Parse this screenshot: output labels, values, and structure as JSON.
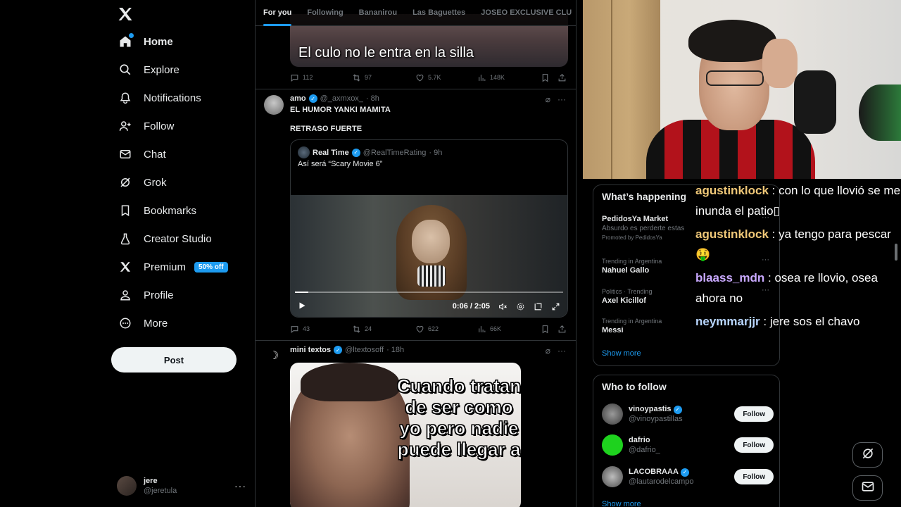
{
  "nav": {
    "items": [
      {
        "label": "Home",
        "icon": "home-icon"
      },
      {
        "label": "Explore",
        "icon": "search-icon"
      },
      {
        "label": "Notifications",
        "icon": "bell-icon"
      },
      {
        "label": "Follow",
        "icon": "person-add-icon"
      },
      {
        "label": "Chat",
        "icon": "mail-icon"
      },
      {
        "label": "Grok",
        "icon": "grok-icon"
      },
      {
        "label": "Bookmarks",
        "icon": "bookmark-icon"
      },
      {
        "label": "Creator Studio",
        "icon": "flask-icon"
      },
      {
        "label": "Premium",
        "icon": "x-logo-icon"
      },
      {
        "label": "Profile",
        "icon": "person-icon"
      },
      {
        "label": "More",
        "icon": "more-circle-icon"
      }
    ],
    "premium_badge": "50% off",
    "post_label": "Post",
    "account": {
      "name": "jere",
      "handle": "@jeretula",
      "more": "···"
    }
  },
  "feed": {
    "tabs": [
      "For you",
      "Following",
      "Bananirou",
      "Las Baguettes",
      "JOSEO EXCLUSIVE CLU"
    ],
    "top_post": {
      "caption": "El culo no le entra en la silla",
      "replies": "112",
      "reposts": "97",
      "likes": "5.7K",
      "views": "148K"
    },
    "post2": {
      "name": "amo",
      "handle": "@_axmxox_",
      "time": "· 8h",
      "text_line1": "EL HUMOR YANKI MAMITA",
      "text_line2": "RETRASO FUERTE",
      "quote": {
        "name": "Real Time",
        "handle": "@RealTimeRating",
        "time": "· 9h",
        "text": "Así será “Scary Movie 6”",
        "video_time": "0:06 / 2:05",
        "video_progress": 0.05
      },
      "replies": "43",
      "reposts": "24",
      "likes": "622",
      "views": "66K"
    },
    "post3": {
      "name": "mini textos",
      "handle": "@ltextosoff",
      "time": "· 18h",
      "meme_text": "Cuando tratan de ser como yo pero nadie puede llegar a"
    }
  },
  "whats_happening": {
    "title": "What’s happening",
    "items": [
      {
        "meta": "",
        "title": "PedidosYa Market",
        "sub": "Absurdo es perderte estas",
        "promo": "Promoted by PedidosYa"
      },
      {
        "meta": "Trending in Argentina",
        "title": "Nahuel Gallo"
      },
      {
        "meta": "Politics · Trending",
        "title": "Axel Kicillof"
      },
      {
        "meta": "Trending in Argentina",
        "title": "Messi"
      }
    ],
    "show_more": "Show more"
  },
  "who_to_follow": {
    "title": "Who to follow",
    "items": [
      {
        "name": "vinoypastis",
        "handle": "@vinoypastillas",
        "verified": true
      },
      {
        "name": "dafrio",
        "handle": "@dafrio_",
        "verified": false
      },
      {
        "name": "LACOBRAAA",
        "handle": "@lautarodelcampo",
        "verified": true
      }
    ],
    "follow_label": "Follow",
    "show_more": "Show more"
  },
  "chat": [
    {
      "user": "agustinklock",
      "color": "#f0c878",
      "msg": ": con lo que llovió se me inunda el patio▯"
    },
    {
      "user": "agustinklock",
      "color": "#f0c878",
      "msg": ": ya tengo para pescar 🤑"
    },
    {
      "user": "blaass_mdn",
      "color": "#c9a9ff",
      "msg": ": osea re llovio, osea ahora no"
    },
    {
      "user": "neymmarjjr",
      "color": "#b9d7ff",
      "msg": ": jere sos el chavo"
    }
  ]
}
